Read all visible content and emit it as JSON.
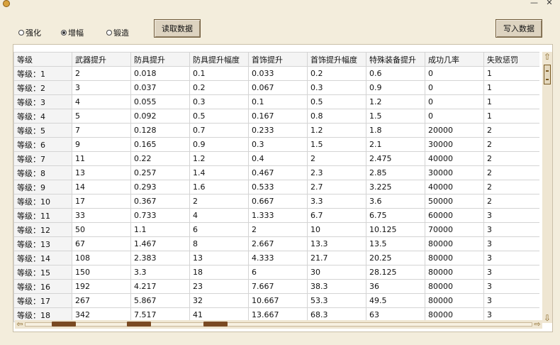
{
  "window": {
    "minimize": "—",
    "close": "✕"
  },
  "radios": [
    {
      "label": "强化",
      "checked": false
    },
    {
      "label": "增幅",
      "checked": true
    },
    {
      "label": "锻造",
      "checked": false
    }
  ],
  "buttons": {
    "read": "读取数据",
    "write": "写入数据"
  },
  "table": {
    "columns": [
      "等级",
      "武器提升",
      "防具提升",
      "防具提升幅度",
      "首饰提升",
      "首饰提升幅度",
      "特殊装备提升",
      "成功几率",
      "失败惩罚"
    ],
    "rows": [
      [
        "等级：1",
        "2",
        "0.018",
        "0.1",
        "0.033",
        "0.2",
        "0.6",
        "0",
        "1"
      ],
      [
        "等级：2",
        "3",
        "0.037",
        "0.2",
        "0.067",
        "0.3",
        "0.9",
        "0",
        "1"
      ],
      [
        "等级：3",
        "4",
        "0.055",
        "0.3",
        "0.1",
        "0.5",
        "1.2",
        "0",
        "1"
      ],
      [
        "等级：4",
        "5",
        "0.092",
        "0.5",
        "0.167",
        "0.8",
        "1.5",
        "0",
        "1"
      ],
      [
        "等级：5",
        "7",
        "0.128",
        "0.7",
        "0.233",
        "1.2",
        "1.8",
        "20000",
        "2"
      ],
      [
        "等级：6",
        "9",
        "0.165",
        "0.9",
        "0.3",
        "1.5",
        "2.1",
        "30000",
        "2"
      ],
      [
        "等级：7",
        "11",
        "0.22",
        "1.2",
        "0.4",
        "2",
        "2.475",
        "40000",
        "2"
      ],
      [
        "等级：8",
        "13",
        "0.257",
        "1.4",
        "0.467",
        "2.3",
        "2.85",
        "30000",
        "2"
      ],
      [
        "等级：9",
        "14",
        "0.293",
        "1.6",
        "0.533",
        "2.7",
        "3.225",
        "40000",
        "2"
      ],
      [
        "等级：10",
        "17",
        "0.367",
        "2",
        "0.667",
        "3.3",
        "3.6",
        "50000",
        "2"
      ],
      [
        "等级：11",
        "33",
        "0.733",
        "4",
        "1.333",
        "6.7",
        "6.75",
        "60000",
        "3"
      ],
      [
        "等级：12",
        "50",
        "1.1",
        "6",
        "2",
        "10",
        "10.125",
        "70000",
        "3"
      ],
      [
        "等级：13",
        "67",
        "1.467",
        "8",
        "2.667",
        "13.3",
        "13.5",
        "80000",
        "3"
      ],
      [
        "等级：14",
        "108",
        "2.383",
        "13",
        "4.333",
        "21.7",
        "20.25",
        "80000",
        "3"
      ],
      [
        "等级：15",
        "150",
        "3.3",
        "18",
        "6",
        "30",
        "28.125",
        "80000",
        "3"
      ],
      [
        "等级：16",
        "192",
        "4.217",
        "23",
        "7.667",
        "38.3",
        "36",
        "80000",
        "3"
      ],
      [
        "等级：17",
        "267",
        "5.867",
        "32",
        "10.667",
        "53.3",
        "49.5",
        "80000",
        "3"
      ],
      [
        "等级：18",
        "342",
        "7.517",
        "41",
        "13.667",
        "68.3",
        "63",
        "80000",
        "3"
      ]
    ]
  },
  "icons": {
    "scroll_up": "⇧",
    "scroll_down": "⇩",
    "scroll_left": "⇦",
    "scroll_right": "⇨"
  },
  "colors": {
    "accent": "#7a4a22",
    "background": "#f3eddc"
  }
}
